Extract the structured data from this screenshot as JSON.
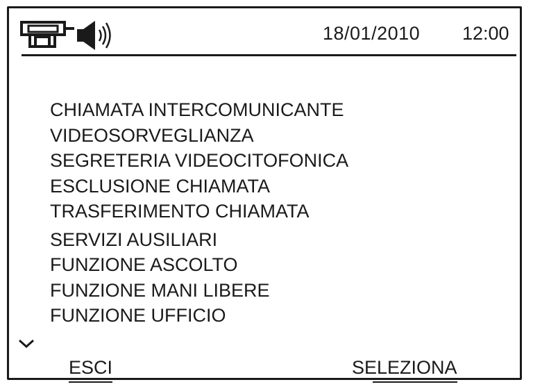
{
  "header": {
    "date": "18/01/2010",
    "time": "12:00",
    "icons": [
      "intercom-icon",
      "speaker-icon"
    ]
  },
  "menu": {
    "items": [
      "CHIAMATA INTERCOMUNICANTE",
      "VIDEOSORVEGLIANZA",
      "SEGRETERIA VIDEOCITOFONICA",
      "ESCLUSIONE CHIAMATA",
      "TRASFERIMENTO CHIAMATA",
      "SERVIZI AUSILIARI",
      "FUNZIONE ASCOLTO",
      "FUNZIONE MANI LIBERE",
      "FUNZIONE UFFICIO"
    ]
  },
  "scroll": {
    "icon": "chevron-down-icon"
  },
  "softkeys": {
    "left": "ESCI",
    "right": "SELEZIONA"
  }
}
